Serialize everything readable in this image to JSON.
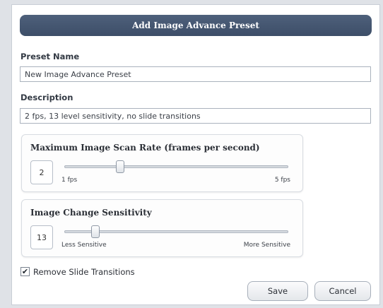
{
  "dialog": {
    "title": "Add Image Advance Preset"
  },
  "preset_name": {
    "label": "Preset Name",
    "value": "New Image Advance Preset"
  },
  "description": {
    "label": "Description",
    "value": "2 fps, 13 level sensitivity, no slide transitions"
  },
  "scan_rate": {
    "title": "Maximum Image Scan Rate (frames per second)",
    "value": "2",
    "min_label": "1 fps",
    "max_label": "5 fps",
    "level": 0.25
  },
  "sensitivity": {
    "title": "Image Change Sensitivity",
    "value": "13",
    "min_label": "Less Sensitive",
    "max_label": "More Sensitive",
    "level": 0.14
  },
  "remove_transitions": {
    "label": "Remove Slide Transitions",
    "checked": true,
    "check_glyph": "✔"
  },
  "buttons": {
    "save": "Save",
    "cancel": "Cancel"
  }
}
